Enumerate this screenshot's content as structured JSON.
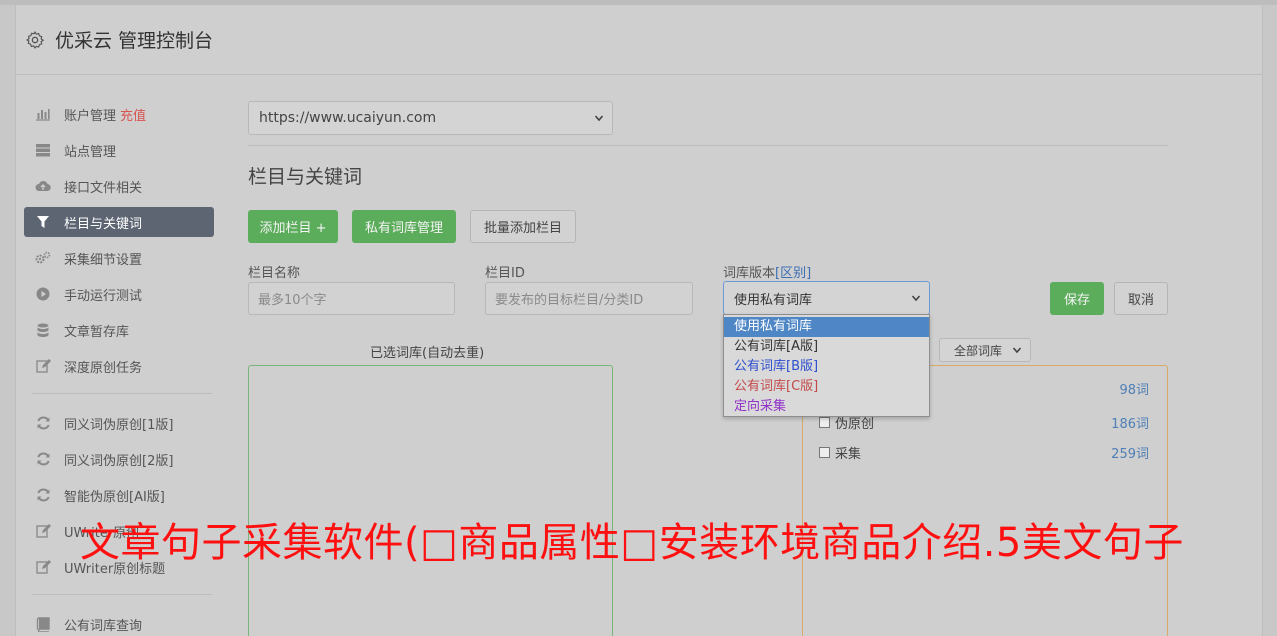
{
  "header": {
    "title": "优采云 管理控制台",
    "icon": "gear-icon"
  },
  "sidebar": {
    "group1": [
      {
        "label": "账户管理",
        "badge": "充值",
        "icon": "bar-chart-icon"
      },
      {
        "label": "站点管理",
        "icon": "server-icon"
      },
      {
        "label": "接口文件相关",
        "icon": "cloud-upload-icon"
      },
      {
        "label": "栏目与关键词",
        "icon": "filter-icon",
        "active": true
      },
      {
        "label": "采集细节设置",
        "icon": "cogs-icon"
      },
      {
        "label": "手动运行测试",
        "icon": "play-circle-icon"
      },
      {
        "label": "文章暂存库",
        "icon": "database-icon"
      },
      {
        "label": "深度原创任务",
        "icon": "edit-icon"
      }
    ],
    "group2": [
      {
        "label": "同义词伪原创[1版]",
        "icon": "refresh-icon"
      },
      {
        "label": "同义词伪原创[2版]",
        "icon": "refresh-icon"
      },
      {
        "label": "智能伪原创[AI版]",
        "icon": "refresh-icon"
      },
      {
        "label": "UWriter原创",
        "icon": "edit-icon"
      },
      {
        "label": "UWriter原创标题",
        "icon": "edit-icon"
      }
    ],
    "group3": [
      {
        "label": "公有词库查询",
        "icon": "book-icon"
      }
    ]
  },
  "main": {
    "site_select": "https://www.ucaiyun.com",
    "section_title": "栏目与关键词",
    "buttons": {
      "add_column": "添加栏目 +",
      "private_lib": "私有词库管理",
      "batch_add": "批量添加栏目",
      "save": "保存",
      "cancel": "取消"
    },
    "form": {
      "name_label": "栏目名称",
      "name_placeholder": "最多10个字",
      "id_label": "栏目ID",
      "id_placeholder": "要发布的目标栏目/分类ID",
      "version_label": "词库版本",
      "version_link": "[区别]",
      "version_value": "使用私有词库"
    },
    "dropdown_options": [
      {
        "label": "使用私有词库",
        "color": "#ffffff",
        "selected": true
      },
      {
        "label": "公有词库[A版]",
        "color": "#333333"
      },
      {
        "label": "公有词库[B版]",
        "color": "#2d4fd0"
      },
      {
        "label": "公有词库[C版]",
        "color": "#c44a4a"
      },
      {
        "label": "定向采集",
        "color": "#9032c8"
      }
    ],
    "selected_libs_title": "已选词库(自动去重)",
    "all_libs_filter": "全部词库",
    "libraries": [
      {
        "name": "",
        "count": "98词"
      },
      {
        "name": "伪原创",
        "count": "186词"
      },
      {
        "name": "采集",
        "count": "259词"
      }
    ]
  },
  "overlay_text": "文章句子采集软件(□商品属性□安装环境商品介绍.5美文句子"
}
